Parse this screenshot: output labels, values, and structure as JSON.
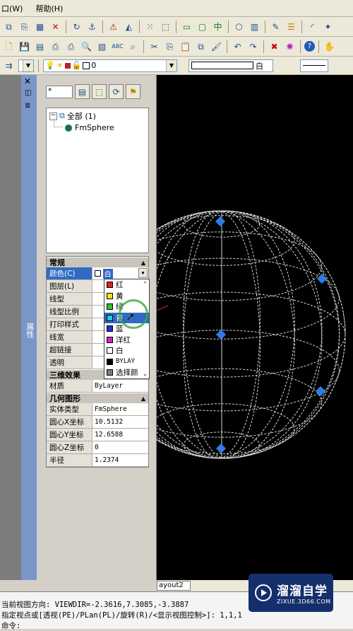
{
  "menu": {
    "items": [
      "口(W)",
      "帮助(H)"
    ]
  },
  "toolbar3": {
    "layer_value": "0",
    "color_value": "白"
  },
  "palette": {
    "side_label": "属性",
    "filter_value": "*",
    "tree": {
      "root": "全部 (1)",
      "child": "FmSphere"
    },
    "sections": {
      "general": "常规",
      "three_d": "三维效果",
      "geometry": "几何图形"
    },
    "general_rows": [
      {
        "name": "颜色(C)",
        "value": "白"
      },
      {
        "name": "图层(L)",
        "value": ""
      },
      {
        "name": "线型",
        "value": ""
      },
      {
        "name": "线型比例",
        "value": ""
      },
      {
        "name": "打印样式",
        "value": ""
      },
      {
        "name": "线宽",
        "value": ""
      },
      {
        "name": "超链接",
        "value": ""
      },
      {
        "name": "透明",
        "value": ""
      }
    ],
    "threed_rows": [
      {
        "name": "材质",
        "value": "ByLayer"
      }
    ],
    "geometry_rows": [
      {
        "name": "实体类型",
        "value": "FmSphere"
      },
      {
        "name": "圆心X坐标",
        "value": "10.5132"
      },
      {
        "name": "圆心Y坐标",
        "value": "12.6588"
      },
      {
        "name": "圆心Z坐标",
        "value": "0"
      },
      {
        "name": "半径",
        "value": "1.2374"
      }
    ],
    "color_dropdown": [
      {
        "label": "红",
        "color": "#e02020"
      },
      {
        "label": "黄",
        "color": "#f0e020"
      },
      {
        "label": "绿",
        "color": "#30c030"
      },
      {
        "label": "青",
        "color": "#20d0d0"
      },
      {
        "label": "蓝",
        "color": "#2030d0"
      },
      {
        "label": "洋红",
        "color": "#d020d0"
      },
      {
        "label": "白",
        "color": "#ffffff"
      },
      {
        "label": "BYLAY",
        "color": "#000000"
      },
      {
        "label": "选择颜",
        "color": "#7a7a7a"
      }
    ]
  },
  "layout_tab": "ayout2",
  "status": {
    "line1": "当前视图方向:  VIEWDIR=-2.3616,7.3085,-3.3887",
    "line2": "指定视点或[透视(PE)/PLan(PL)/旋转(R)/<显示视图控制>]: 1,1,1",
    "line3": "命令:"
  },
  "logo": {
    "title": "溜溜自学",
    "subtitle": "ZIXUE.3D66.COM"
  }
}
